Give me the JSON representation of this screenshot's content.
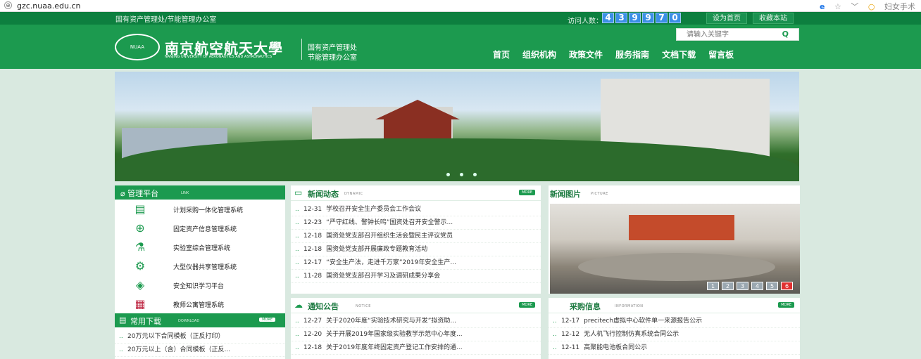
{
  "browser": {
    "url": "gzc.nuaa.edu.cn",
    "lock_icon": "globe-icon",
    "ext_label": "妇女手术"
  },
  "topbar": {
    "org": "国有资产管理处/节能管理办公室",
    "visit_label": "访问人数：",
    "visit_digits": [
      "4",
      "3",
      "9",
      "9",
      "7",
      "0"
    ],
    "set_home": "设为首页",
    "bookmark": "收藏本站"
  },
  "header": {
    "seal_text": "NUAA",
    "univ_cn": "南京航空航天大學",
    "univ_en": "NANJING UNIVERSITY OF AERONAUTICS AND ASTRONAUTICS",
    "dept_line1": "国有资产管理处",
    "dept_line2": "节能管理办公室",
    "search_placeholder": "请输入关键字",
    "nav": [
      "首页",
      "组织机构",
      "政策文件",
      "服务指南",
      "文档下载",
      "留言板"
    ]
  },
  "mgmt": {
    "title": "管理平台",
    "en": "LINK",
    "items": [
      {
        "label": "计划采购一体化管理系统",
        "icon": "clipboard-icon"
      },
      {
        "label": "固定资产信息管理系统",
        "icon": "asset-icon"
      },
      {
        "label": "实验室综合管理系统",
        "icon": "flask-icon"
      },
      {
        "label": "大型仪器共享管理系统",
        "icon": "instrument-icon"
      },
      {
        "label": "安全知识学习平台",
        "icon": "shield-icon"
      },
      {
        "label": "教师公寓管理系统",
        "icon": "building-icon"
      }
    ]
  },
  "downloads": {
    "title": "常用下载",
    "en": "DOWNLOAD",
    "more": "MORE",
    "items": [
      "20万元以下合同模板（正反打印）",
      "20万元以上（含）合同模板（正反..."
    ]
  },
  "news": {
    "title": "新闻动态",
    "en": "DYNAMIC",
    "more": "MORE",
    "items": [
      {
        "date": "12-31",
        "text": "学校召开安全生产委员会工作会议"
      },
      {
        "date": "12-23",
        "text": "“严守红线、警钟长鸣”国资处召开安全警示..."
      },
      {
        "date": "12-18",
        "text": "国资处党支部召开组织生活会暨民主评议党员"
      },
      {
        "date": "12-18",
        "text": "国资处党支部开展廉政专题教育活动"
      },
      {
        "date": "12-17",
        "text": "“安全生产法，走进千万家”2019年安全生产..."
      },
      {
        "date": "11-28",
        "text": "国资处党支部召开学习及调研成果分享会"
      }
    ]
  },
  "photos": {
    "title": "新闻图片",
    "en": "PICTURE",
    "pages": [
      "1",
      "2",
      "3",
      "4",
      "5",
      "6"
    ],
    "active_page": "6"
  },
  "notice": {
    "title": "通知公告",
    "en": "NOTICE",
    "more": "MORE",
    "items": [
      {
        "date": "12-27",
        "text": "关于2020年度“实验技术研究与开发”拟资助..."
      },
      {
        "date": "12-20",
        "text": "关于开展2019年国家级实验教学示范中心年度..."
      },
      {
        "date": "12-18",
        "text": "关于2019年度年终固定资产登记工作安排的通..."
      }
    ]
  },
  "purchase": {
    "title": "采购信息",
    "en": "INFORMATION",
    "more": "MORE",
    "items": [
      {
        "date": "12-17",
        "text": "precitech虚拟中心软件单一来源报告公示"
      },
      {
        "date": "12-12",
        "text": "无人机飞行控制仿真系统合同公示"
      },
      {
        "date": "12-11",
        "text": "高聚能电池板合同公示"
      }
    ]
  }
}
